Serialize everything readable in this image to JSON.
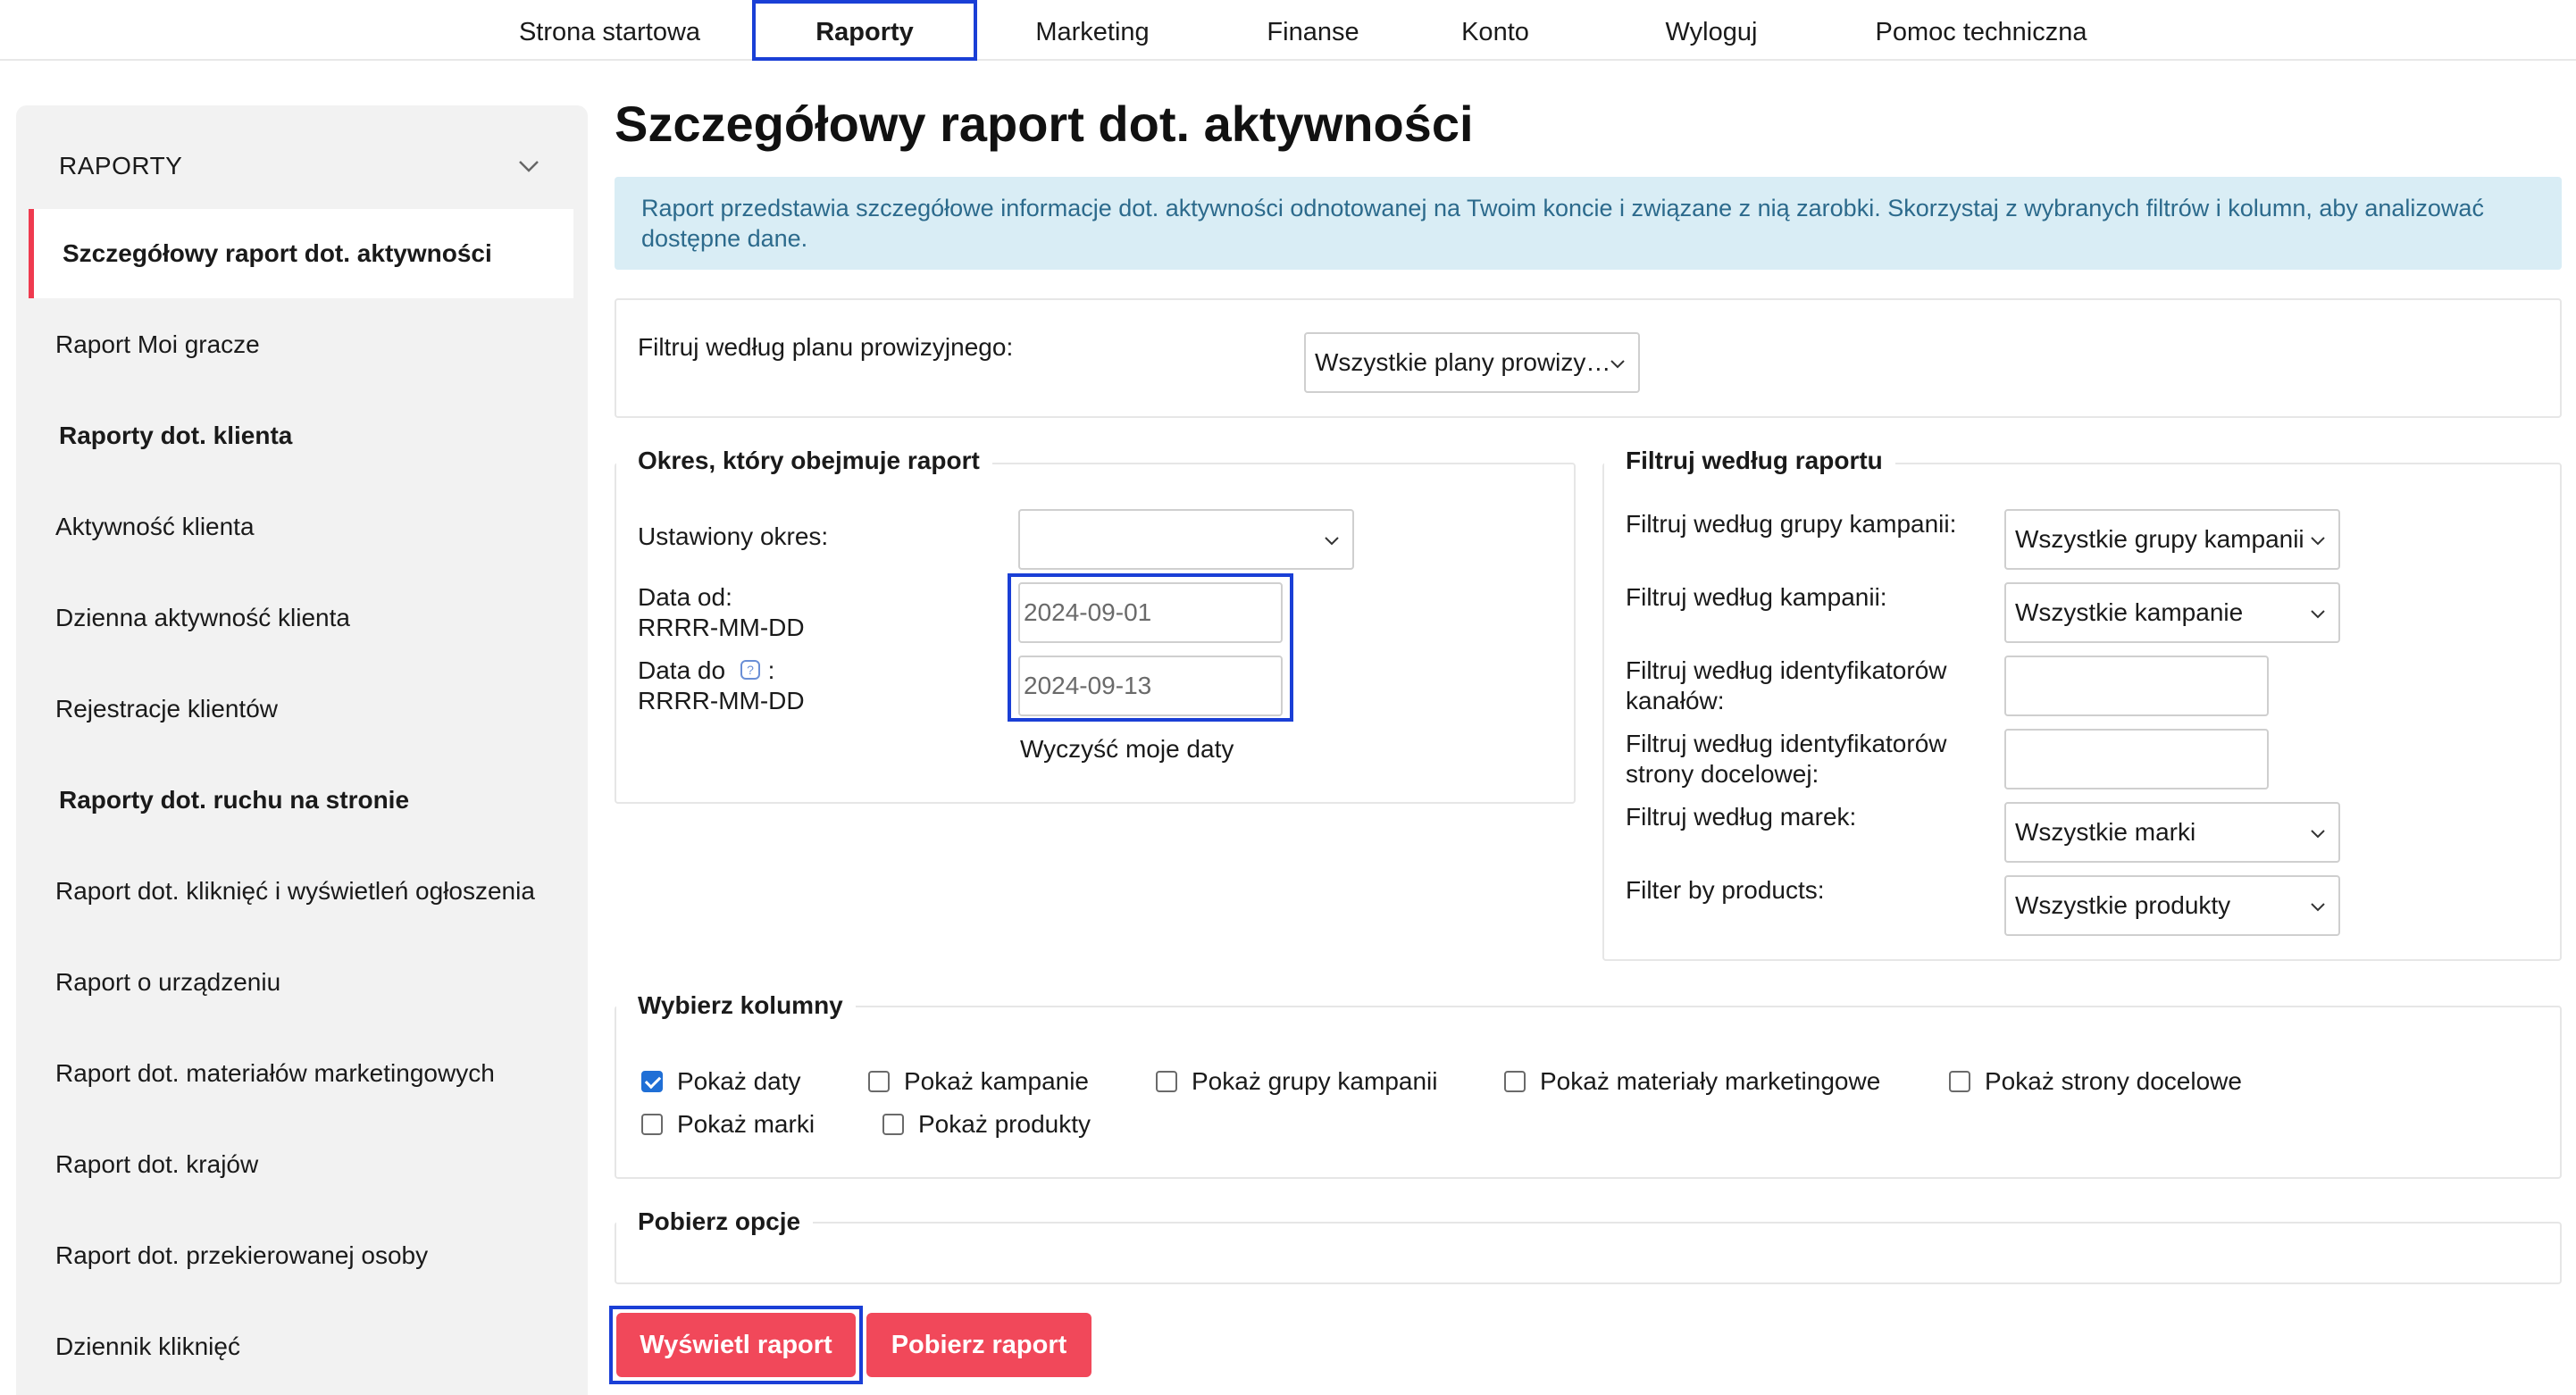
{
  "nav": {
    "items": [
      {
        "label": "Strona startowa"
      },
      {
        "label": "Raporty"
      },
      {
        "label": "Marketing"
      },
      {
        "label": "Finanse"
      },
      {
        "label": "Konto"
      },
      {
        "label": "Wyloguj"
      },
      {
        "label": "Pomoc techniczna"
      }
    ],
    "active": "Raporty"
  },
  "sidebar": {
    "header": "RAPORTY",
    "items": [
      {
        "label": "Szczegółowy raport dot. aktywności",
        "type": "active"
      },
      {
        "label": "Raport Moi gracze",
        "type": "link"
      },
      {
        "label": "Raporty dot. klienta",
        "type": "section"
      },
      {
        "label": "Aktywność klienta",
        "type": "link"
      },
      {
        "label": "Dzienna aktywność klienta",
        "type": "link"
      },
      {
        "label": "Rejestracje klientów",
        "type": "link"
      },
      {
        "label": "Raporty dot. ruchu na stronie",
        "type": "section"
      },
      {
        "label": "Raport dot. kliknięć i wyświetleń ogłoszenia",
        "type": "link"
      },
      {
        "label": "Raport o urządzeniu",
        "type": "link"
      },
      {
        "label": "Raport dot. materiałów marketingowych",
        "type": "link"
      },
      {
        "label": "Raport dot. krajów",
        "type": "link"
      },
      {
        "label": "Raport dot. przekierowanej osoby",
        "type": "link"
      },
      {
        "label": "Dziennik kliknięć",
        "type": "link"
      }
    ]
  },
  "main": {
    "title": "Szczegółowy raport dot. aktywności",
    "info": "Raport przedstawia szczegółowe informacje dot. aktywności odnotowanej na Twoim koncie i związane z nią zarobki. Skorzystaj z wybranych filtrów i kolumn, aby analizować dostępne dane.",
    "commission": {
      "label": "Filtruj według planu prowizyjnego:",
      "value": "Wszystkie plany prowizy…"
    },
    "period": {
      "legend": "Okres, który obejmuje raport",
      "set_period_label": "Ustawiony okres:",
      "set_period_value": "",
      "date_from_label": "Data od:",
      "date_from_format": "RRRR-MM-DD",
      "date_from_value": "2024-09-01",
      "date_to_label": "Data do",
      "date_to_colon": ":",
      "date_to_format": "RRRR-MM-DD",
      "date_to_value": "2024-09-13",
      "clear_label": "Wyczyść moje daty"
    },
    "report_filter": {
      "legend": "Filtruj według raportu",
      "campaign_group_label": "Filtruj według grupy kampanii:",
      "campaign_group_value": "Wszystkie grupy kampanii",
      "campaign_label": "Filtruj według kampanii:",
      "campaign_value": "Wszystkie kampanie",
      "channel_ids_label_1": "Filtruj według identyfikatorów",
      "channel_ids_label_2": "kanałów:",
      "channel_ids_value": "",
      "landing_ids_label_1": "Filtruj według identyfikatorów",
      "landing_ids_label_2": "strony docelowej:",
      "landing_ids_value": "",
      "brands_label": "Filtruj według marek:",
      "brands_value": "Wszystkie marki",
      "products_label": "Filter by products:",
      "products_value": "Wszystkie produkty"
    },
    "columns": {
      "legend": "Wybierz kolumny",
      "options": [
        {
          "label": "Pokaż daty",
          "checked": true
        },
        {
          "label": "Pokaż kampanie",
          "checked": false
        },
        {
          "label": "Pokaż grupy kampanii",
          "checked": false
        },
        {
          "label": "Pokaż materiały marketingowe",
          "checked": false
        },
        {
          "label": "Pokaż strony docelowe",
          "checked": false
        },
        {
          "label": "Pokaż marki",
          "checked": false
        },
        {
          "label": "Pokaż produkty",
          "checked": false
        }
      ]
    },
    "download": {
      "legend": "Pobierz opcje"
    },
    "buttons": {
      "show_report": "Wyświetl raport",
      "download_report": "Pobierz raport"
    }
  },
  "colors": {
    "accent": "#f1485a",
    "highlight": "#1a3fd6",
    "info_bg": "#d9edf5",
    "info_text": "#2c6a8c",
    "sidebar_bg": "#f2f2f2",
    "active_marker": "#ef3a4f"
  }
}
